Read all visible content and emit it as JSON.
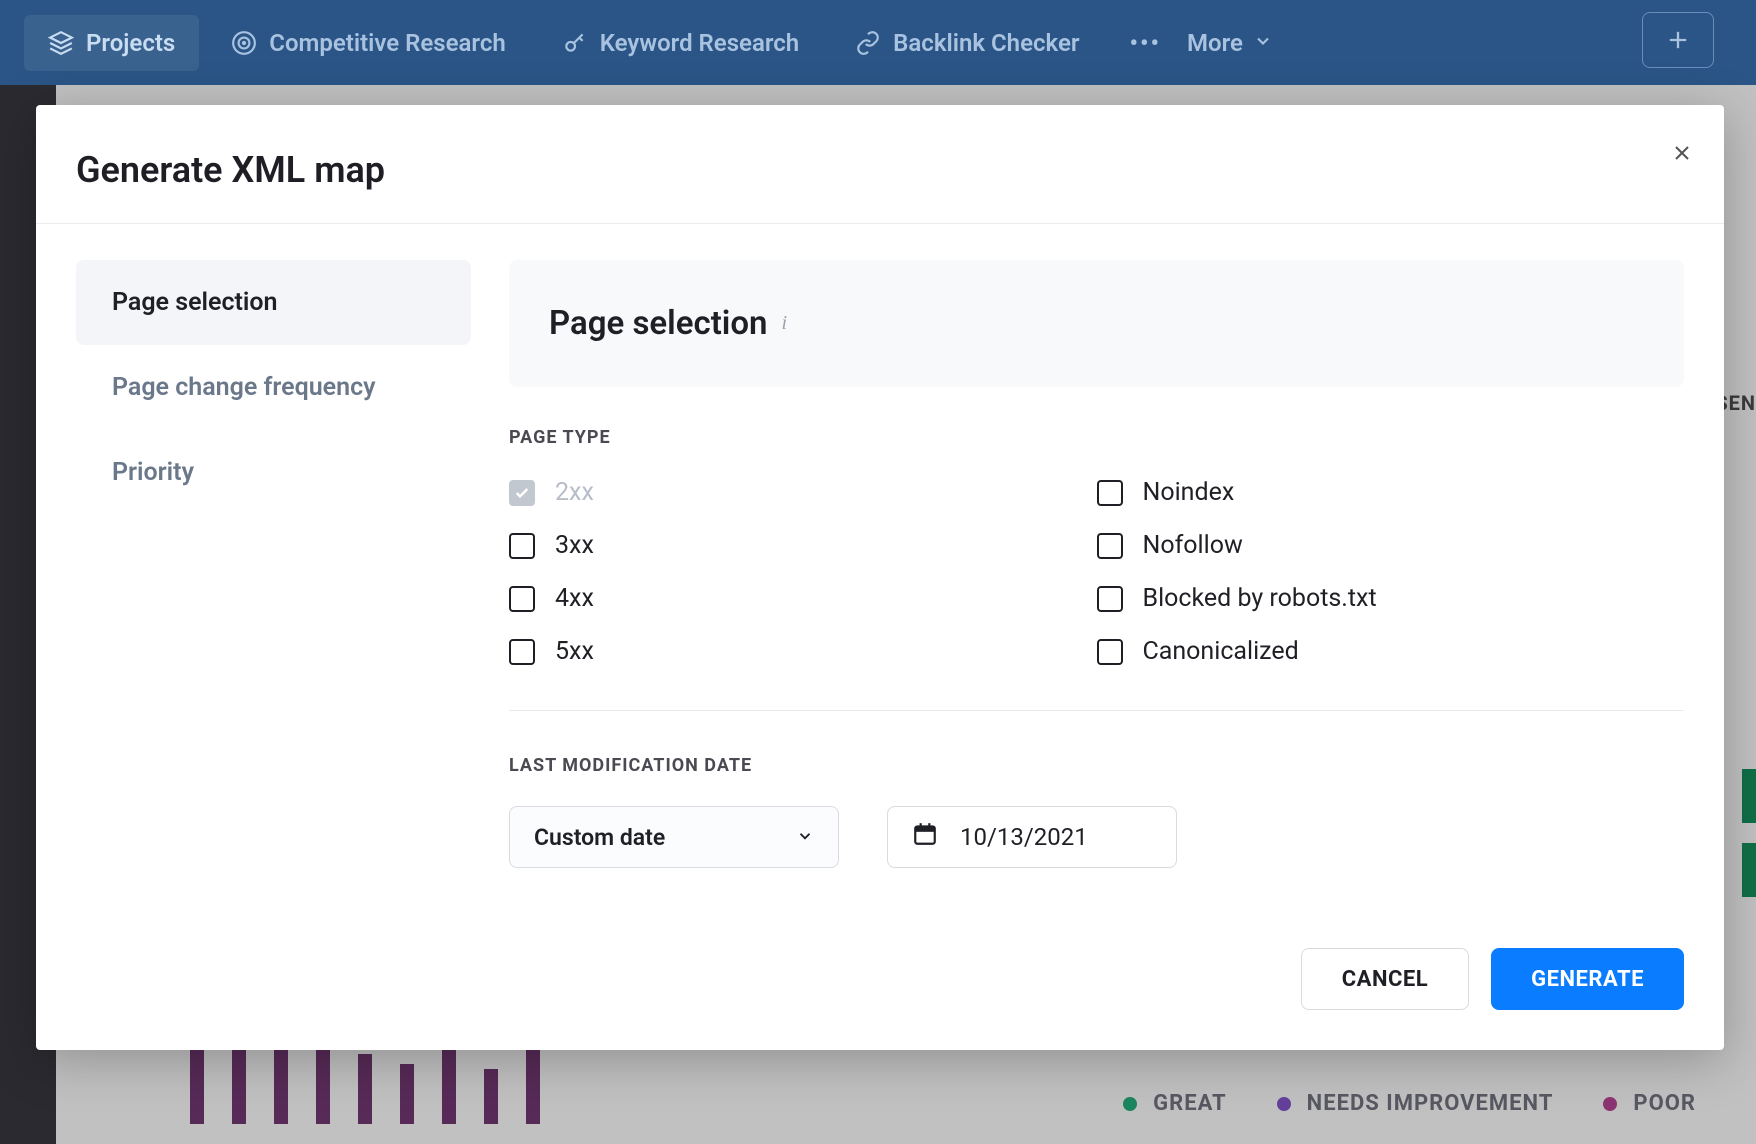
{
  "nav": {
    "items": [
      {
        "label": "Projects",
        "icon": "layers-icon",
        "active": true
      },
      {
        "label": "Competitive Research",
        "icon": "target-icon",
        "active": false
      },
      {
        "label": "Keyword Research",
        "icon": "key-icon",
        "active": false
      },
      {
        "label": "Backlink Checker",
        "icon": "link-icon",
        "active": false
      }
    ],
    "more_label": "More"
  },
  "modal": {
    "title": "Generate XML map",
    "tabs": [
      {
        "label": "Page selection",
        "selected": true
      },
      {
        "label": "Page change frequency",
        "selected": false
      },
      {
        "label": "Priority",
        "selected": false
      }
    ],
    "panel_title": "Page selection",
    "page_type_label": "PAGE TYPE",
    "page_types_left": [
      {
        "label": "2xx",
        "checked": true,
        "disabled": true
      },
      {
        "label": "3xx",
        "checked": false,
        "disabled": false
      },
      {
        "label": "4xx",
        "checked": false,
        "disabled": false
      },
      {
        "label": "5xx",
        "checked": false,
        "disabled": false
      }
    ],
    "page_types_right": [
      {
        "label": "Noindex",
        "checked": false
      },
      {
        "label": "Nofollow",
        "checked": false
      },
      {
        "label": "Blocked by robots.txt",
        "checked": false
      },
      {
        "label": "Canonicalized",
        "checked": false
      }
    ],
    "last_mod_label": "LAST MODIFICATION DATE",
    "date_mode": "Custom date",
    "date_value": "10/13/2021",
    "cancel_label": "CANCEL",
    "generate_label": "GENERATE"
  },
  "bg": {
    "right_text": "SEN",
    "legend": [
      {
        "label": "GREAT",
        "color": "green"
      },
      {
        "label": "NEEDS IMPROVEMENT",
        "color": "purple"
      },
      {
        "label": "POOR",
        "color": "mag"
      }
    ]
  }
}
